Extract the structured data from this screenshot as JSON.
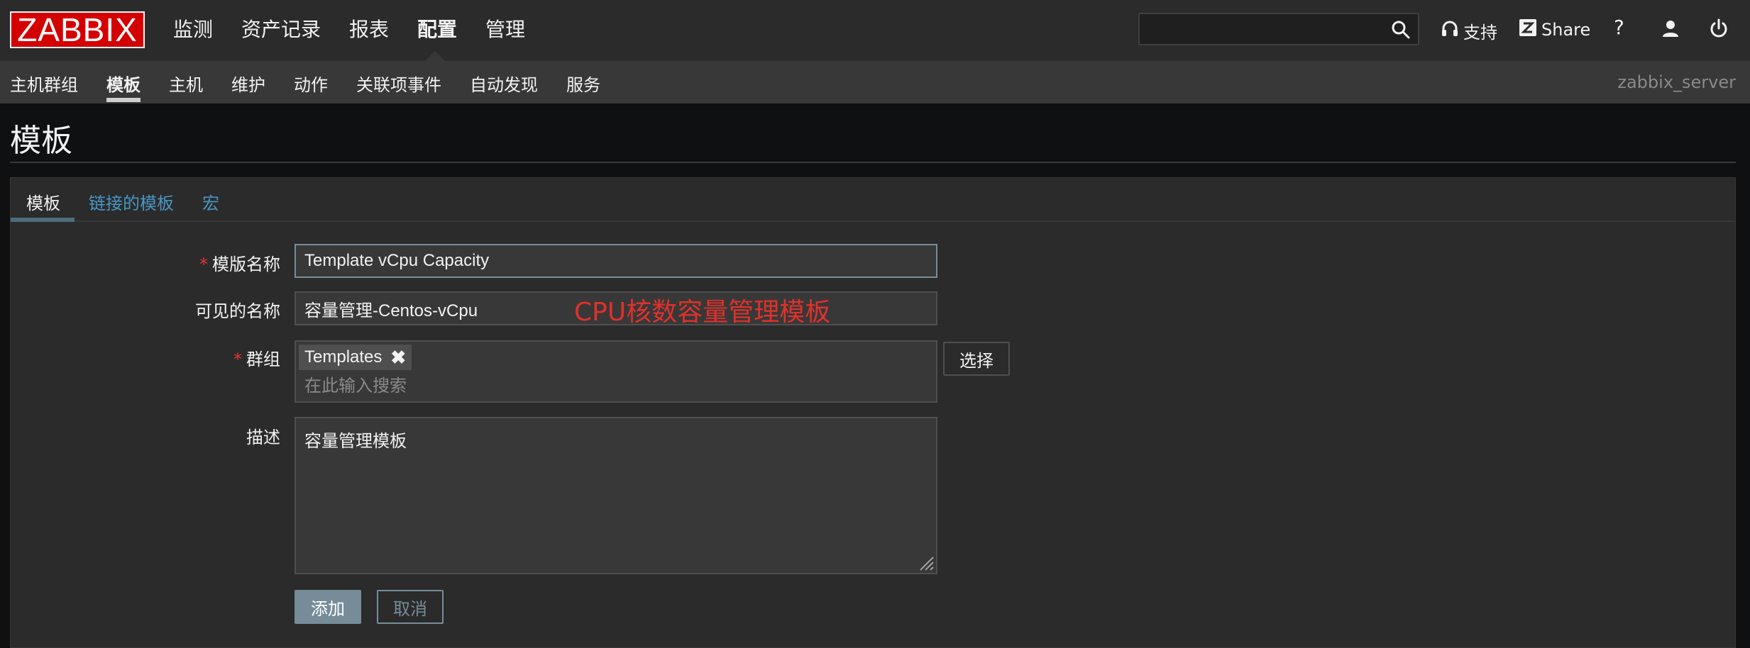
{
  "header": {
    "logo": "ZABBIX",
    "main_nav": [
      "监测",
      "资产记录",
      "报表",
      "配置",
      "管理"
    ],
    "active_main_nav": "配置",
    "search": {
      "value": "",
      "placeholder": ""
    },
    "support_label": "支持",
    "share_label": "Share",
    "help_label": "?"
  },
  "subnav": {
    "items": [
      "主机群组",
      "模板",
      "主机",
      "维护",
      "动作",
      "关联项事件",
      "自动发现",
      "服务"
    ],
    "active": "模板",
    "server_name": "zabbix_server"
  },
  "page": {
    "title": "模板"
  },
  "tabs": [
    {
      "label": "模板",
      "active": true
    },
    {
      "label": "链接的模板",
      "active": false
    },
    {
      "label": "宏",
      "active": false
    }
  ],
  "form": {
    "template_name": {
      "label": "模版名称",
      "required": true,
      "value": "Template vCpu Capacity"
    },
    "visible_name": {
      "label": "可见的名称",
      "required": false,
      "value": "容量管理-Centos-vCpu"
    },
    "annotation": "CPU核数容量管理模板",
    "groups": {
      "label": "群组",
      "required": true,
      "selected": [
        "Templates"
      ],
      "placeholder": "在此输入搜索",
      "select_button": "选择"
    },
    "description": {
      "label": "描述",
      "value": "容量管理模板"
    },
    "add_button": "添加",
    "cancel_button": "取消"
  },
  "colors": {
    "logo_bg": "#d40000",
    "link": "#4796c4",
    "required": "#e33734",
    "annotation": "#e0312b",
    "primary_button": "#768d99"
  }
}
